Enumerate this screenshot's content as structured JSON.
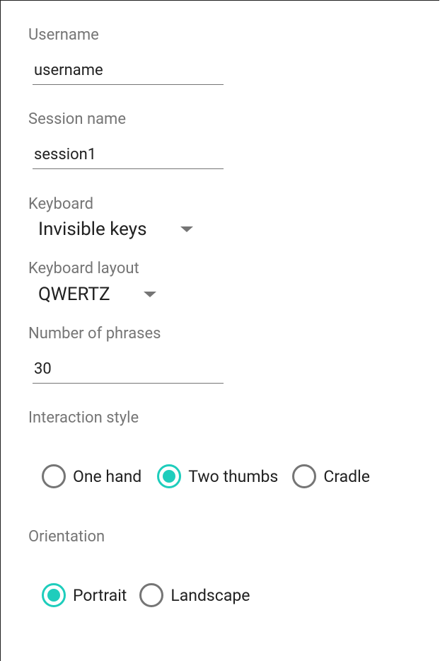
{
  "accent_color": "#1ecdbc",
  "username": {
    "label": "Username",
    "value": "username"
  },
  "session_name": {
    "label": "Session name",
    "value": "session1"
  },
  "keyboard": {
    "label": "Keyboard",
    "selected": "Invisible keys",
    "icon": "dropdown-arrow-icon"
  },
  "keyboard_layout": {
    "label": "Keyboard layout",
    "selected": "QWERTZ",
    "icon": "dropdown-arrow-icon"
  },
  "number_of_phrases": {
    "label": "Number of phrases",
    "value": "30"
  },
  "interaction_style": {
    "label": "Interaction style",
    "options": [
      {
        "label": "One hand",
        "checked": false
      },
      {
        "label": "Two thumbs",
        "checked": true
      },
      {
        "label": "Cradle",
        "checked": false
      }
    ]
  },
  "orientation": {
    "label": "Orientation",
    "options": [
      {
        "label": "Portrait",
        "checked": true
      },
      {
        "label": "Landscape",
        "checked": false
      }
    ]
  }
}
